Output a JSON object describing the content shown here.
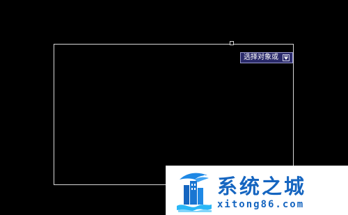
{
  "canvas": {
    "background": "#000000",
    "object_outline_color": "#d8d8d8"
  },
  "tooltip": {
    "text": "选择对象或",
    "button_icon": "down-arrow-icon",
    "background": "#2a2a6a"
  },
  "watermark": {
    "brand": "系统之城",
    "url": "xitong86.com",
    "logo_icon": "city-dragon-logo",
    "color": "#1565c0"
  }
}
